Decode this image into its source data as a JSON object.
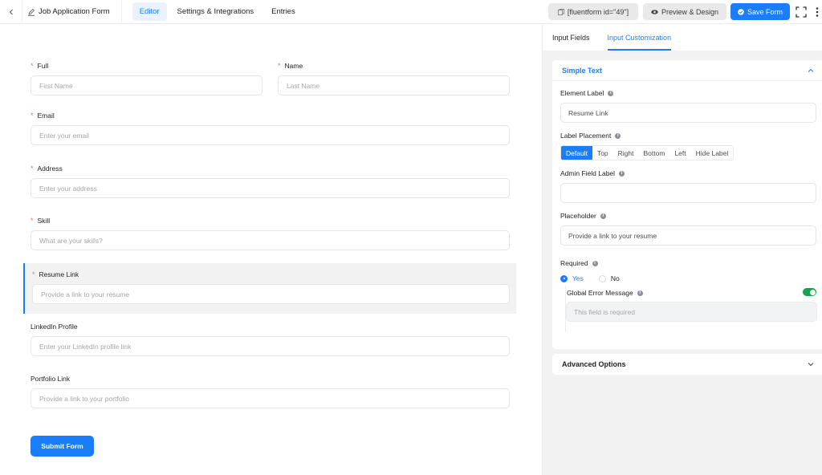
{
  "topbar": {
    "back_icon": "chevron-left-icon",
    "form_title": "Job Application Form",
    "form_title_icon": "pen-icon",
    "tabs": [
      {
        "label": "Editor",
        "active": true
      },
      {
        "label": "Settings & Integrations",
        "active": false
      },
      {
        "label": "Entries",
        "active": false
      }
    ],
    "shortcode_label": "[fluentform id=\"49\"]",
    "shortcode_icon": "copy-icon",
    "preview_label": "Preview & Design",
    "preview_icon": "eye-icon",
    "save_label": "Save Form",
    "save_icon": "check-circle-icon",
    "fullscreen_icon": "fullscreen-icon",
    "more_icon": "vertical-dots-icon"
  },
  "form": {
    "fields": [
      {
        "label": "Full",
        "required": true,
        "placeholder": "First Name"
      },
      {
        "label": "Name",
        "required": true,
        "placeholder": "Last Name"
      },
      {
        "label": "Email",
        "required": true,
        "placeholder": "Enter your email"
      },
      {
        "label": "Address",
        "required": true,
        "placeholder": "Enter your address"
      },
      {
        "label": "Skill",
        "required": true,
        "placeholder": "What are your skills?"
      },
      {
        "label": "Resume Link",
        "required": true,
        "placeholder": "Provide a link to your resume",
        "selected": true
      },
      {
        "label": "LinkedIn Profile",
        "required": false,
        "placeholder": "Enter your LinkedIn profile link"
      },
      {
        "label": "Portfolio Link",
        "required": false,
        "placeholder": "Provide a link to your portfolio"
      }
    ],
    "required_mark": "*",
    "submit_label": "Submit Form"
  },
  "panel": {
    "tabs": [
      {
        "label": "Input Fields",
        "active": false
      },
      {
        "label": "Input Customization",
        "active": true
      }
    ],
    "simple_text": {
      "title": "Simple Text",
      "element_label": {
        "label": "Element Label",
        "value": "Resume Link"
      },
      "label_placement": {
        "label": "Label Placement",
        "options": [
          "Default",
          "Top",
          "Right",
          "Bottom",
          "Left",
          "Hide Label"
        ],
        "selected": "Default"
      },
      "admin_field_label": {
        "label": "Admin Field Label",
        "value": ""
      },
      "placeholder": {
        "label": "Placeholder",
        "value": "Provide a link to your resume"
      },
      "required": {
        "label": "Required",
        "options": [
          "Yes",
          "No"
        ],
        "selected": "Yes"
      },
      "global_error": {
        "label": "Global Error Message",
        "enabled": true,
        "placeholder": "This field is required"
      }
    },
    "advanced": {
      "title": "Advanced Options"
    },
    "info_glyph": "i"
  }
}
